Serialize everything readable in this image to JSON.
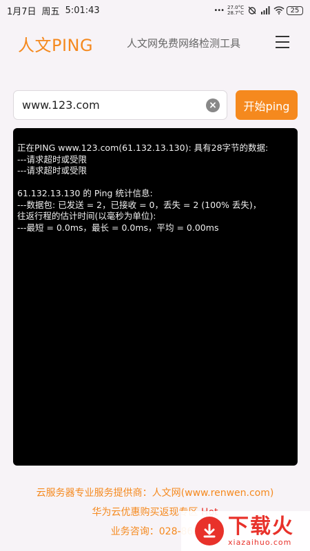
{
  "status": {
    "date": "1月7日",
    "weekday": "周五",
    "time": "5:01:43",
    "temp_high": "27.0°C",
    "temp_low": "28.7°C",
    "battery": "25"
  },
  "header": {
    "brand": "人文PING",
    "subtitle": "人文网免费网络检测工具"
  },
  "search": {
    "value": "www.123.com",
    "button_label": "开始ping"
  },
  "console": {
    "lines": [
      "正在PING www.123.com(61.132.13.130): 具有28字节的数据:",
      "---请求超时或受限",
      "---请求超时或受限",
      "",
      "61.132.13.130 的 Ping 统计信息:",
      "---数据包: 已发送 = 2，已接收 = 0，丢失 = 2 (100% 丢失)，",
      "往返行程的估计时间(以毫秒为单位):",
      "---最短 = 0.0ms，最长 = 0.0ms，平均 = 0.00ms"
    ]
  },
  "footer": {
    "line1": "云服务器专业服务提供商：人文网(www.renwen.com)",
    "line2": "华为云优惠购买返现专区",
    "line2_hot": "Hot",
    "line3": "业务咨询：028-866"
  },
  "watermark": {
    "main": "下载火",
    "sub": "xiazaihuo.com"
  },
  "colors": {
    "accent": "#f5891e",
    "hot": "#e8312a",
    "console_bg": "#000000"
  }
}
